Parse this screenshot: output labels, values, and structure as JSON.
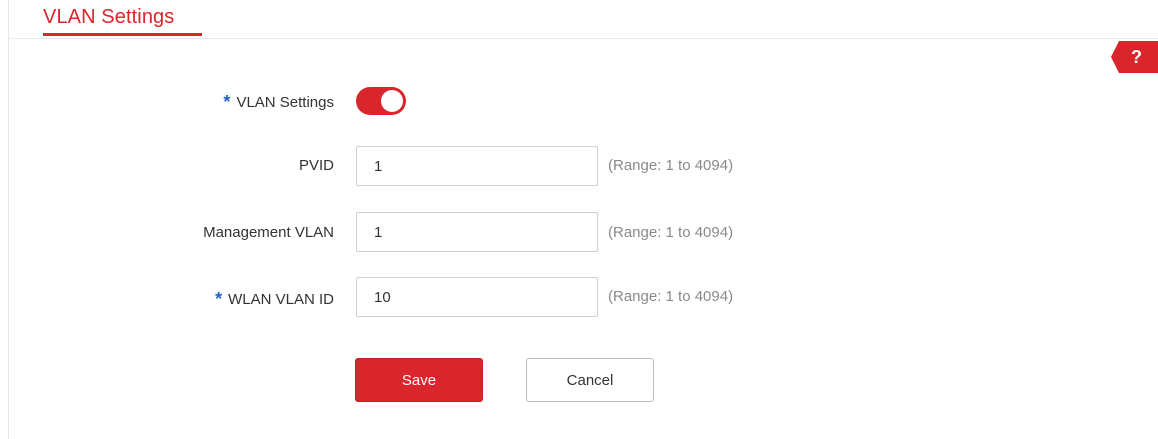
{
  "section": {
    "title": "VLAN Settings"
  },
  "help": {
    "label": "?"
  },
  "form": {
    "required_marker": "*",
    "vlan_settings": {
      "label": "VLAN Settings",
      "enabled": true
    },
    "pvid": {
      "label": "PVID",
      "value": "1",
      "hint": "(Range: 1 to 4094)"
    },
    "management_vlan": {
      "label": "Management VLAN",
      "value": "1",
      "hint": "(Range: 1 to 4094)"
    },
    "wlan_vlan_id": {
      "label": "WLAN VLAN ID",
      "value": "10",
      "hint": "(Range: 1 to 4094)"
    }
  },
  "actions": {
    "save_label": "Save",
    "cancel_label": "Cancel"
  },
  "colors": {
    "accent": "#d8262c",
    "required": "#1f64c8"
  }
}
